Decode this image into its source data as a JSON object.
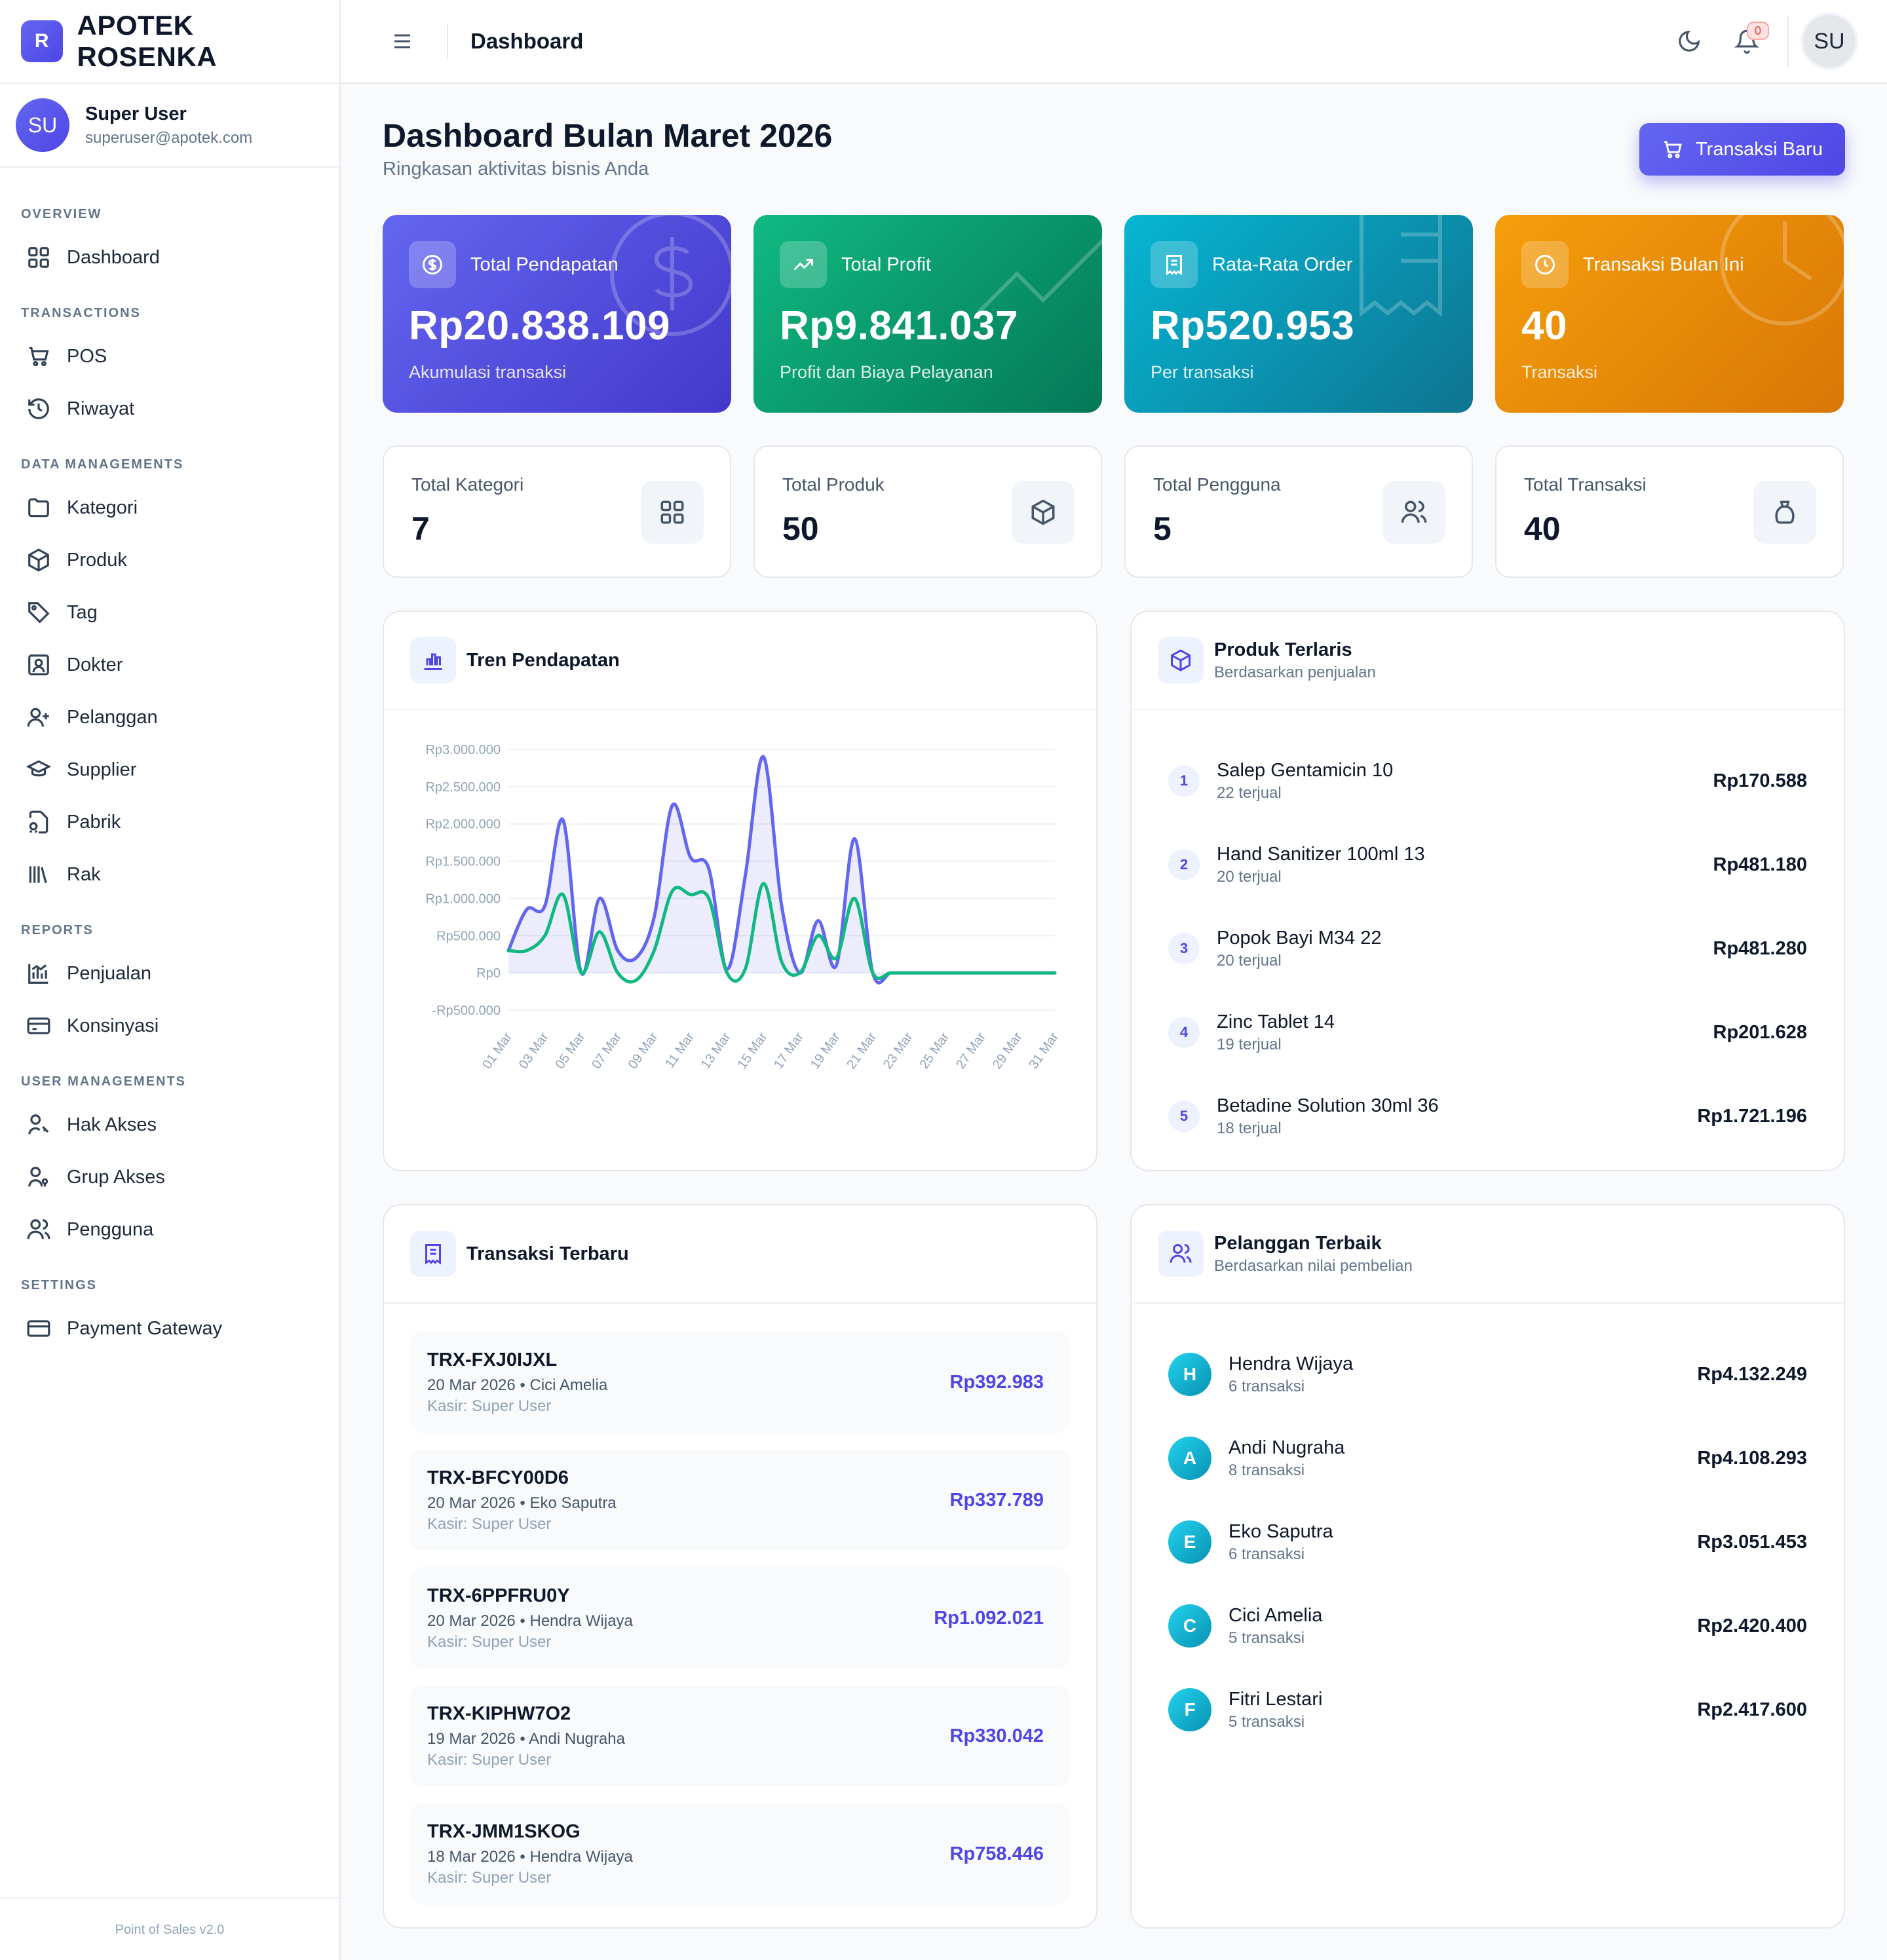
{
  "brand": {
    "logo_letter": "R",
    "name": "APOTEK ROSENKA"
  },
  "user": {
    "initials": "SU",
    "name": "Super User",
    "email": "superuser@apotek.com"
  },
  "nav": {
    "overview": {
      "title": "OVERVIEW",
      "items": [
        {
          "label": "Dashboard",
          "icon": "grid-icon"
        }
      ]
    },
    "transactions": {
      "title": "TRANSACTIONS",
      "items": [
        {
          "label": "POS",
          "icon": "cart-icon"
        },
        {
          "label": "Riwayat",
          "icon": "history-icon"
        }
      ]
    },
    "data": {
      "title": "DATA MANAGEMENTS",
      "items": [
        {
          "label": "Kategori",
          "icon": "folder-icon"
        },
        {
          "label": "Produk",
          "icon": "box-icon"
        },
        {
          "label": "Tag",
          "icon": "tag-icon"
        },
        {
          "label": "Dokter",
          "icon": "doctor-icon"
        },
        {
          "label": "Pelanggan",
          "icon": "user-plus-icon"
        },
        {
          "label": "Supplier",
          "icon": "graduation-icon"
        },
        {
          "label": "Pabrik",
          "icon": "factory-icon"
        },
        {
          "label": "Rak",
          "icon": "library-icon"
        }
      ]
    },
    "reports": {
      "title": "REPORTS",
      "items": [
        {
          "label": "Penjualan",
          "icon": "bar-chart-icon"
        },
        {
          "label": "Konsinyasi",
          "icon": "card-icon"
        }
      ]
    },
    "users": {
      "title": "USER MANAGEMENTS",
      "items": [
        {
          "label": "Hak Akses",
          "icon": "user-key-icon"
        },
        {
          "label": "Grup Akses",
          "icon": "user-group-key-icon"
        },
        {
          "label": "Pengguna",
          "icon": "users-icon"
        }
      ]
    },
    "settings": {
      "title": "SETTINGS",
      "items": [
        {
          "label": "Payment Gateway",
          "icon": "credit-card-icon"
        }
      ]
    }
  },
  "footer": {
    "version": "Point of Sales v2.0"
  },
  "header": {
    "title": "Dashboard",
    "notif_count": "0",
    "avatar": "SU"
  },
  "page": {
    "title": "Dashboard Bulan Maret 2026",
    "subtitle": "Ringkasan aktivitas bisnis Anda",
    "new_trx_label": "Transaksi Baru"
  },
  "stats": [
    {
      "label": "Total Pendapatan",
      "value": "Rp20.838.109",
      "note": "Akumulasi transaksi",
      "icon": "dollar-icon",
      "color": "#4f46e5"
    },
    {
      "label": "Total Profit",
      "value": "Rp9.841.037",
      "note": "Profit dan Biaya Pelayanan",
      "icon": "trending-up-icon",
      "color": "#059669"
    },
    {
      "label": "Rata-Rata Order",
      "value": "Rp520.953",
      "note": "Per transaksi",
      "icon": "receipt-icon",
      "color": "#0891b2"
    },
    {
      "label": "Transaksi Bulan Ini",
      "value": "40",
      "note": "Transaksi",
      "icon": "clock-icon",
      "color": "#f59e0b"
    }
  ],
  "mini_stats": [
    {
      "label": "Total Kategori",
      "value": "7",
      "icon": "grid-icon"
    },
    {
      "label": "Total Produk",
      "value": "50",
      "icon": "box-icon"
    },
    {
      "label": "Total Pengguna",
      "value": "5",
      "icon": "users-icon"
    },
    {
      "label": "Total Transaksi",
      "value": "40",
      "icon": "bag-icon"
    }
  ],
  "trend_panel": {
    "title": "Tren Pendapatan"
  },
  "chart_data": {
    "type": "area",
    "title": "Tren Pendapatan",
    "x": [
      "01 Mar",
      "02 Mar",
      "03 Mar",
      "04 Mar",
      "05 Mar",
      "06 Mar",
      "07 Mar",
      "08 Mar",
      "09 Mar",
      "10 Mar",
      "11 Mar",
      "12 Mar",
      "13 Mar",
      "14 Mar",
      "15 Mar",
      "16 Mar",
      "17 Mar",
      "18 Mar",
      "19 Mar",
      "20 Mar",
      "21 Mar",
      "22 Mar",
      "23 Mar",
      "24 Mar",
      "25 Mar",
      "26 Mar",
      "27 Mar",
      "28 Mar",
      "29 Mar",
      "30 Mar",
      "31 Mar"
    ],
    "x_tick_labels": [
      "01 Mar",
      "03 Mar",
      "05 Mar",
      "07 Mar",
      "09 Mar",
      "11 Mar",
      "13 Mar",
      "15 Mar",
      "17 Mar",
      "19 Mar",
      "21 Mar",
      "23 Mar",
      "25 Mar",
      "27 Mar",
      "29 Mar",
      "31 Mar"
    ],
    "y_tick_labels": [
      "Rp3.000.000",
      "Rp2.500.000",
      "Rp2.000.000",
      "Rp1.500.000",
      "Rp1.000.000",
      "Rp500.000",
      "Rp0",
      "-Rp500.000"
    ],
    "ylim": [
      -500000,
      3000000
    ],
    "series": [
      {
        "color": "#6366f1",
        "values": [
          300000,
          850000,
          900000,
          2050000,
          0,
          1000000,
          300000,
          200000,
          750000,
          2250000,
          1550000,
          1400000,
          50000,
          1300000,
          2900000,
          900000,
          0,
          700000,
          100000,
          1800000,
          0,
          0,
          0,
          0,
          0,
          0,
          0,
          0,
          0,
          0,
          0
        ]
      },
      {
        "color": "#10b981",
        "values": [
          300000,
          300000,
          500000,
          1050000,
          0,
          550000,
          0,
          -100000,
          300000,
          1100000,
          1050000,
          1000000,
          0,
          50000,
          1200000,
          150000,
          0,
          500000,
          200000,
          1000000,
          0,
          0,
          0,
          0,
          0,
          0,
          0,
          0,
          0,
          0,
          0
        ]
      }
    ],
    "grid": true
  },
  "top_products": {
    "title": "Produk Terlaris",
    "subtitle": "Berdasarkan penjualan",
    "items": [
      {
        "rank": "1",
        "name": "Salep Gentamicin 10",
        "sub": "22 terjual",
        "amount": "Rp170.588"
      },
      {
        "rank": "2",
        "name": "Hand Sanitizer 100ml 13",
        "sub": "20 terjual",
        "amount": "Rp481.180"
      },
      {
        "rank": "3",
        "name": "Popok Bayi M34 22",
        "sub": "20 terjual",
        "amount": "Rp481.280"
      },
      {
        "rank": "4",
        "name": "Zinc Tablet 14",
        "sub": "19 terjual",
        "amount": "Rp201.628"
      },
      {
        "rank": "5",
        "name": "Betadine Solution 30ml 36",
        "sub": "18 terjual",
        "amount": "Rp1.721.196"
      }
    ]
  },
  "recent_trx": {
    "title": "Transaksi Terbaru",
    "items": [
      {
        "code": "TRX-FXJ0IJXL",
        "meta": "20 Mar 2026 • Cici Amelia",
        "kasir": "Kasir: Super User",
        "amount": "Rp392.983"
      },
      {
        "code": "TRX-BFCY00D6",
        "meta": "20 Mar 2026 • Eko Saputra",
        "kasir": "Kasir: Super User",
        "amount": "Rp337.789"
      },
      {
        "code": "TRX-6PPFRU0Y",
        "meta": "20 Mar 2026 • Hendra Wijaya",
        "kasir": "Kasir: Super User",
        "amount": "Rp1.092.021"
      },
      {
        "code": "TRX-KIPHW7O2",
        "meta": "19 Mar 2026 • Andi Nugraha",
        "kasir": "Kasir: Super User",
        "amount": "Rp330.042"
      },
      {
        "code": "TRX-JMM1SKOG",
        "meta": "18 Mar 2026 • Hendra Wijaya",
        "kasir": "Kasir: Super User",
        "amount": "Rp758.446"
      }
    ]
  },
  "top_customers": {
    "title": "Pelanggan Terbaik",
    "subtitle": "Berdasarkan nilai pembelian",
    "items": [
      {
        "initial": "H",
        "name": "Hendra Wijaya",
        "sub": "6 transaksi",
        "amount": "Rp4.132.249"
      },
      {
        "initial": "A",
        "name": "Andi Nugraha",
        "sub": "8 transaksi",
        "amount": "Rp4.108.293"
      },
      {
        "initial": "E",
        "name": "Eko Saputra",
        "sub": "6 transaksi",
        "amount": "Rp3.051.453"
      },
      {
        "initial": "C",
        "name": "Cici Amelia",
        "sub": "5 transaksi",
        "amount": "Rp2.420.400"
      },
      {
        "initial": "F",
        "name": "Fitri Lestari",
        "sub": "5 transaksi",
        "amount": "Rp2.417.600"
      }
    ]
  }
}
